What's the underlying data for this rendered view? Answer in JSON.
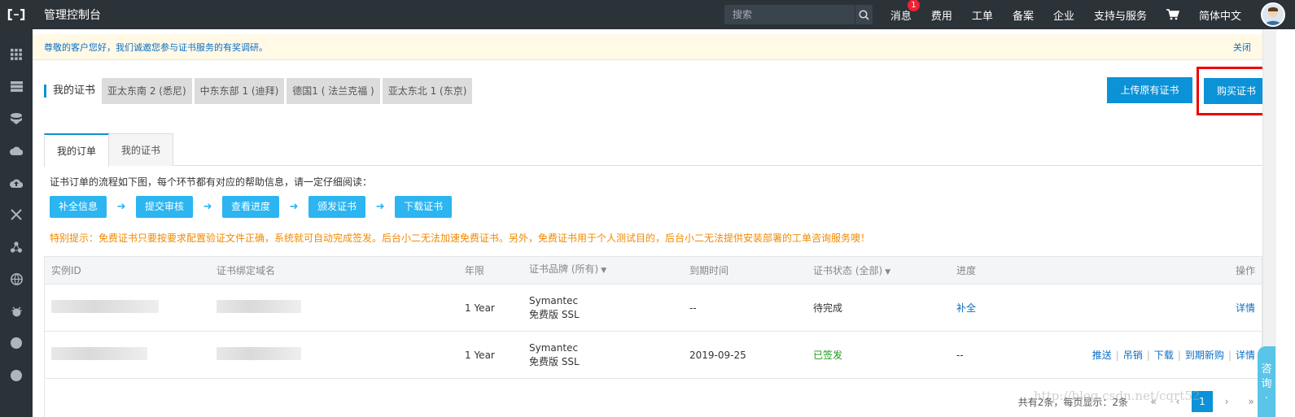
{
  "topbar": {
    "title": "管理控制台",
    "search_placeholder": "搜索",
    "nav": {
      "messages": "消息",
      "messages_count": "1",
      "billing": "费用",
      "tickets": "工单",
      "filing": "备案",
      "enterprise": "企业",
      "support": "支持与服务",
      "language": "简体中文"
    }
  },
  "notice": {
    "text": "尊敬的客户您好，我们诚邀您参与证书服务的有奖调研。",
    "close": "关闭"
  },
  "region": {
    "label": "我的证书",
    "tabs": [
      "亚太东南 2 (悉尼)",
      "中东东部 1 (迪拜)",
      "德国1 ( 法兰克福 )",
      "亚太东北 1 (东京)"
    ]
  },
  "buttons": {
    "upload": "上传原有证书",
    "buy": "购买证书"
  },
  "tabs": [
    "我的订单",
    "我的证书"
  ],
  "flow": {
    "description": "证书订单的流程如下图，每个环节都有对应的帮助信息，请一定仔细阅读：",
    "steps": [
      "补全信息",
      "提交审核",
      "查看进度",
      "颁发证书",
      "下载证书"
    ],
    "tip": "特别提示：免费证书只要按要求配置验证文件正确，系统就可自动完成签发。后台小二无法加速免费证书。另外，免费证书用于个人测试目的，后台小二无法提供安装部署的工单咨询服务噢！"
  },
  "table": {
    "headers": {
      "instance_id": "实例ID",
      "domain": "证书绑定域名",
      "term": "年限",
      "brand": "证书品牌 (所有)",
      "expiry": "到期时间",
      "status": "证书状态 (全部)",
      "progress": "进度",
      "actions": "操作"
    },
    "rows": [
      {
        "term": "1 Year",
        "brand_line1": "Symantec",
        "brand_line2": "免费版 SSL",
        "expiry": "--",
        "status": "待完成",
        "progress": "补全",
        "action_detail": "详情"
      },
      {
        "term": "1 Year",
        "brand_line1": "Symantec",
        "brand_line2": "免费版 SSL",
        "expiry": "2019-09-25",
        "status": "已签发",
        "progress": "--",
        "action_push": "推送",
        "action_revoke": "吊销",
        "action_download": "下载",
        "action_renew": "到期新购",
        "action_detail": "详情"
      }
    ]
  },
  "pager": {
    "summary": "共有2条，每页显示：2条",
    "first": "«",
    "prev": "‹",
    "current": "1",
    "next": "›",
    "last": "»"
  },
  "watermark": "http://blog.csdn.net/cqrt52",
  "consult": [
    "咨",
    "询",
    "·"
  ],
  "colors": {
    "topbar": "#2b3238",
    "primary": "#0b92d7",
    "step": "#2cb5f0",
    "tip": "#f08a00",
    "success": "#1a9a1a",
    "highlight_box": "#ee0000"
  },
  "icons": {
    "logo": "aliyun-logo-icon",
    "search": "search-icon",
    "cart": "cart-icon",
    "sidebar": [
      "grid-icon",
      "server-icon",
      "database-icon",
      "cloud-icon",
      "cloud-upload-icon",
      "network-icon",
      "cluster-icon",
      "globe-icon",
      "bug-icon",
      "circle-icon",
      "circle-icon"
    ]
  }
}
